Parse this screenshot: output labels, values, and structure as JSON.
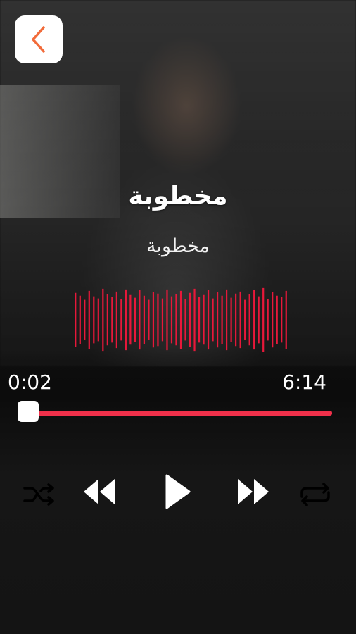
{
  "header": {
    "back_icon": "chevron-left-icon",
    "accent_color": "#f26b3a"
  },
  "track": {
    "title": "مخطوبة",
    "artist": "مخطوبة"
  },
  "player": {
    "current_time": "0:02",
    "total_time": "6:14",
    "progress_fraction": 0.005,
    "progress_color": "#f0304a",
    "waveform_color": "#e8183a"
  },
  "controls": {
    "shuffle_icon": "shuffle-icon",
    "previous_icon": "rewind-icon",
    "play_icon": "play-icon",
    "next_icon": "fast-forward-icon",
    "repeat_icon": "repeat-icon"
  }
}
